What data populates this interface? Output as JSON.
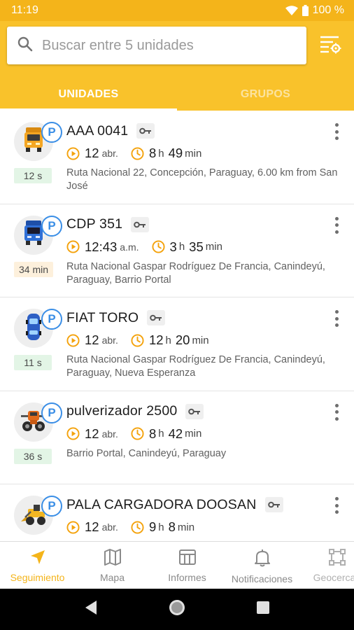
{
  "status_bar": {
    "time": "11:19",
    "battery": "100 %"
  },
  "search": {
    "placeholder": "Buscar entre 5 unidades",
    "value": ""
  },
  "tabs": [
    {
      "label": "UNIDADES",
      "active": true
    },
    {
      "label": "GRUPOS",
      "active": false
    }
  ],
  "units": [
    {
      "name": "AAA 0041",
      "time_value": "12",
      "time_suffix": "abr.",
      "dur_h": "8",
      "dur_h_label": "h",
      "dur_m": "49",
      "dur_m_label": "min",
      "address": "Ruta Nacional 22, Concepción, Paraguay, 6.00 km from San José",
      "age": "12 s",
      "age_status": "green",
      "icon": "truck-icon"
    },
    {
      "name": "CDP 351",
      "time_value": "12:43",
      "time_suffix": "a.m.",
      "dur_h": "3",
      "dur_h_label": "h",
      "dur_m": "35",
      "dur_m_label": "min",
      "address": "Ruta Nacional Gaspar Rodríguez De Francia, Canindeyú, Paraguay, Barrio Portal",
      "age": "34 min",
      "age_status": "orange",
      "icon": "blue-truck-icon"
    },
    {
      "name": "FIAT TORO",
      "time_value": "12",
      "time_suffix": "abr.",
      "dur_h": "12",
      "dur_h_label": "h",
      "dur_m": "20",
      "dur_m_label": "min",
      "address": "Ruta Nacional Gaspar Rodríguez De Francia, Canindeyú, Paraguay, Nueva Esperanza",
      "age": "11 s",
      "age_status": "green",
      "icon": "car-icon"
    },
    {
      "name": "pulverizador 2500",
      "time_value": "12",
      "time_suffix": "abr.",
      "dur_h": "8",
      "dur_h_label": "h",
      "dur_m": "42",
      "dur_m_label": "min",
      "address": "Barrio Portal, Canindeyú, Paraguay",
      "age": "36 s",
      "age_status": "green",
      "icon": "sprayer-icon"
    },
    {
      "name": "PALA CARGADORA DOOSAN",
      "time_value": "12",
      "time_suffix": "abr.",
      "dur_h": "9",
      "dur_h_label": "h",
      "dur_m": "8",
      "dur_m_label": "min",
      "address": "",
      "age": "",
      "age_status": "green",
      "icon": "loader-icon"
    }
  ],
  "badge_letter": "P",
  "bottom_nav": [
    {
      "label": "Seguimiento",
      "icon": "navigation-arrow-icon",
      "active": true
    },
    {
      "label": "Mapa",
      "icon": "map-icon",
      "active": false
    },
    {
      "label": "Informes",
      "icon": "reports-icon",
      "active": false
    },
    {
      "label": "Notificaciones",
      "icon": "bell-icon",
      "active": false
    },
    {
      "label": "Geocercas",
      "icon": "geofence-icon",
      "active": false
    }
  ],
  "colors": {
    "primary": "#f9c22b",
    "status_bar": "#f4b41a",
    "badge_blue": "#3a8ee6",
    "accent_orange": "#f4a20b"
  }
}
